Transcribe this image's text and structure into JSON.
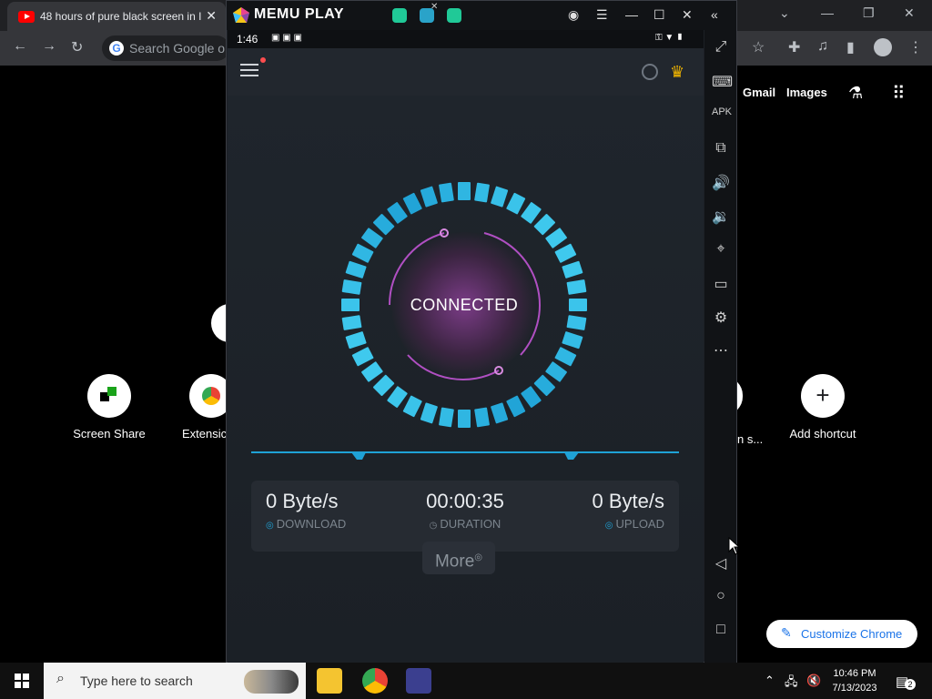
{
  "chrome": {
    "tab_title": "48 hours of pure black screen in I",
    "omnibox_placeholder": "Search Google or",
    "links": [
      "Gmail",
      "Images"
    ],
    "shortcuts": [
      {
        "label": "Screen Share"
      },
      {
        "label": "Extensic"
      },
      {
        "label": "n s..."
      },
      {
        "label": "Add shortcut"
      }
    ],
    "customize_label": "Customize Chrome"
  },
  "memu": {
    "app_name": "MEMU PLAY"
  },
  "android": {
    "time": "1:46"
  },
  "vpn": {
    "status": "CONNECTED",
    "stats": [
      {
        "value": "0 Byte/s",
        "label": "DOWNLOAD"
      },
      {
        "value": "00:00:35",
        "label": "DURATION"
      },
      {
        "value": "0 Byte/s",
        "label": "UPLOAD"
      }
    ],
    "more_label": "More"
  },
  "taskbar": {
    "search_placeholder": "Type here to search",
    "time": "10:46 PM",
    "date": "7/13/2023",
    "notification_count": "2"
  },
  "colors": {
    "accent": "#1fa2d6",
    "ring_glow": "#b04fc2",
    "memu_green": "#20c997"
  }
}
